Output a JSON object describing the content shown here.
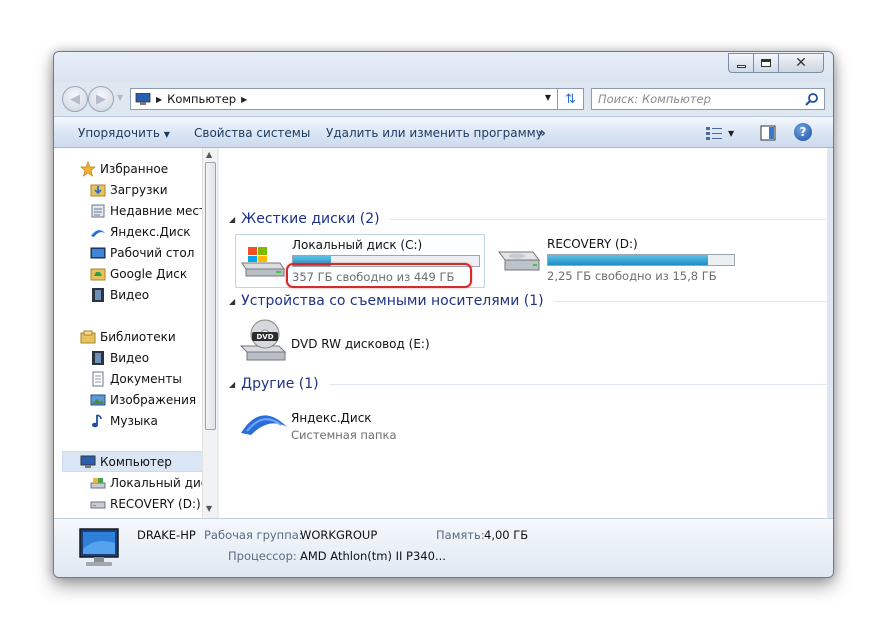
{
  "window": {
    "address_crumb": "Компьютер",
    "search_placeholder": "Поиск: Компьютер"
  },
  "toolbar": {
    "organize": "Упорядочить",
    "system_properties": "Свойства системы",
    "uninstall": "Удалить или изменить программу",
    "more": "»"
  },
  "nav": {
    "favorites": [
      {
        "label": "Избранное",
        "icon": "star-icon"
      },
      {
        "label": "Загрузки",
        "icon": "downloads-folder-icon"
      },
      {
        "label": "Недавние места",
        "icon": "recent-places-icon"
      },
      {
        "label": "Яндекс.Диск",
        "icon": "yandex-disk-icon"
      },
      {
        "label": "Рабочий стол",
        "icon": "desktop-icon"
      },
      {
        "label": "Google Диск",
        "icon": "google-drive-folder-icon"
      },
      {
        "label": "Видео",
        "icon": "video-icon"
      }
    ],
    "libraries": [
      {
        "label": "Библиотеки",
        "icon": "libraries-icon"
      },
      {
        "label": "Видео",
        "icon": "video-icon"
      },
      {
        "label": "Документы",
        "icon": "documents-icon"
      },
      {
        "label": "Изображения",
        "icon": "pictures-icon"
      },
      {
        "label": "Музыка",
        "icon": "music-icon"
      }
    ],
    "computer": [
      {
        "label": "Компьютер",
        "icon": "computer-icon",
        "selected": true
      },
      {
        "label": "Локальный диск",
        "icon": "local-disk-icon"
      },
      {
        "label": "RECOVERY (D:)",
        "icon": "drive-icon"
      }
    ]
  },
  "content": {
    "groups": {
      "hdd": "Жесткие диски (2)",
      "removable": "Устройства со съемными носителями (1)",
      "other": "Другие (1)"
    },
    "drives": [
      {
        "name": "Локальный диск (C:)",
        "free_text": "357 ГБ свободно из 449 ГБ",
        "used_fraction": 0.205
      },
      {
        "name": "RECOVERY (D:)",
        "free_text": "2,25 ГБ свободно из 15,8 ГБ",
        "used_fraction": 0.858
      }
    ],
    "dvd": {
      "name": "DVD RW дисковод (E:)",
      "icon_label": "DVD"
    },
    "other_item": {
      "name": "Яндекс.Диск",
      "subtitle": "Системная папка"
    }
  },
  "details": {
    "computer_name": "DRAKE-HP",
    "workgroup_label": "Рабочая группа:",
    "workgroup_value": "WORKGROUP",
    "memory_label": "Память:",
    "memory_value": "4,00 ГБ",
    "cpu_label": "Процессор:",
    "cpu_value": "AMD Athlon(tm) II P340..."
  },
  "colors": {
    "accent_blue": "#1e3287",
    "highlight_red": "#d22c2c",
    "bar_fill": "#1d8fc4"
  }
}
